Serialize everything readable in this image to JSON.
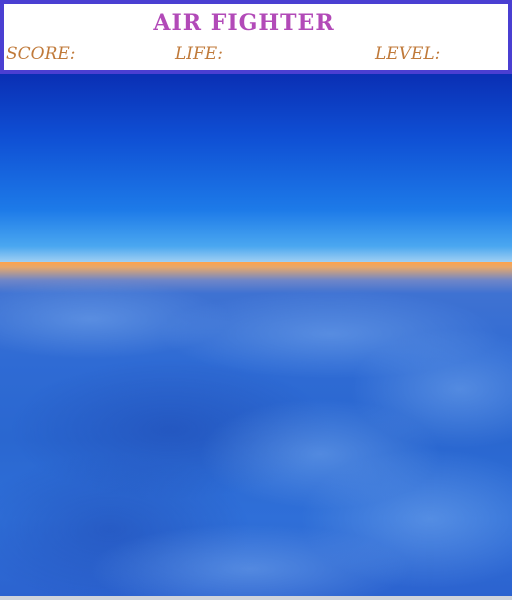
{
  "hud": {
    "title": "AIR FIGHTER",
    "score_label": "SCORE:",
    "life_label": "LIFE:",
    "level_label": "LEVEL:"
  },
  "colors": {
    "hud_border": "#4a3fd2",
    "title": "#b24ab8",
    "labels": "#c07a3a",
    "sky_top": "#0a2fb4",
    "horizon": "#ffa24a",
    "clouds": "#2f6bd4"
  }
}
